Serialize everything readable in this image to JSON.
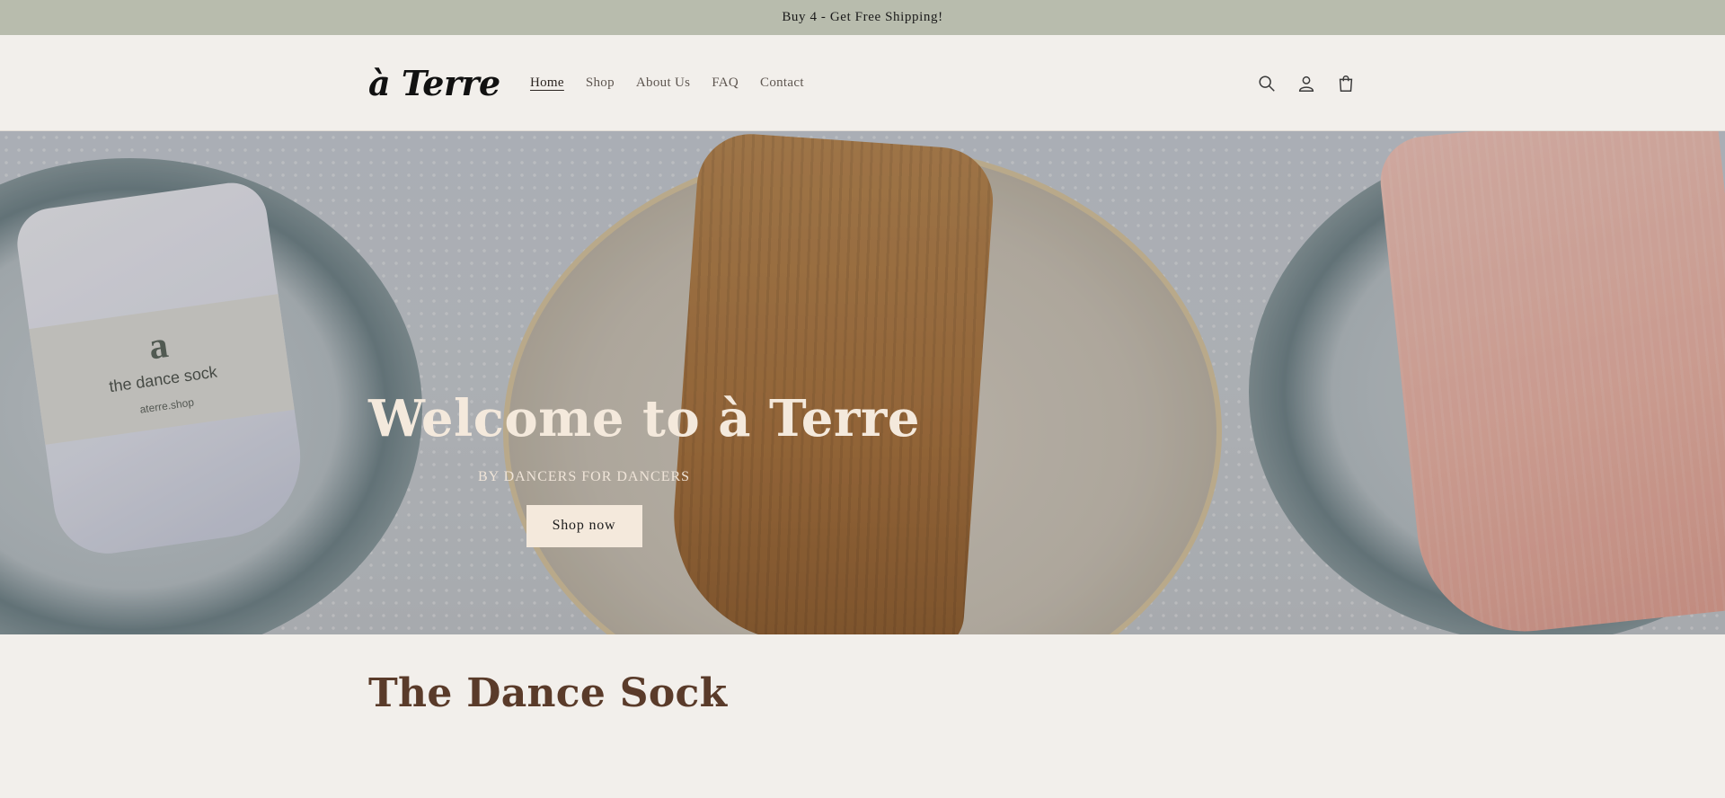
{
  "announcement": {
    "text": "Buy 4 - Get Free Shipping!"
  },
  "header": {
    "logo_text": "à Terre",
    "nav": [
      {
        "label": "Home",
        "active": true
      },
      {
        "label": "Shop",
        "active": false
      },
      {
        "label": "About Us",
        "active": false
      },
      {
        "label": "FAQ",
        "active": false
      },
      {
        "label": "Contact",
        "active": false
      }
    ],
    "icons": [
      "search-icon",
      "account-icon",
      "cart-icon"
    ]
  },
  "hero": {
    "title": "Welcome to à Terre",
    "subtitle": "BY DANCERS FOR DANCERS",
    "button_label": "Shop now",
    "band_logo": "a",
    "band_text": "the dance sock",
    "band_url": "aterre.shop"
  },
  "section": {
    "title": "The Dance Sock"
  },
  "colors": {
    "announcement_bg": "#b8bcad",
    "page_bg": "#f2efeb",
    "heading": "#5a3b2a",
    "hero_text": "#f4e9dc"
  }
}
